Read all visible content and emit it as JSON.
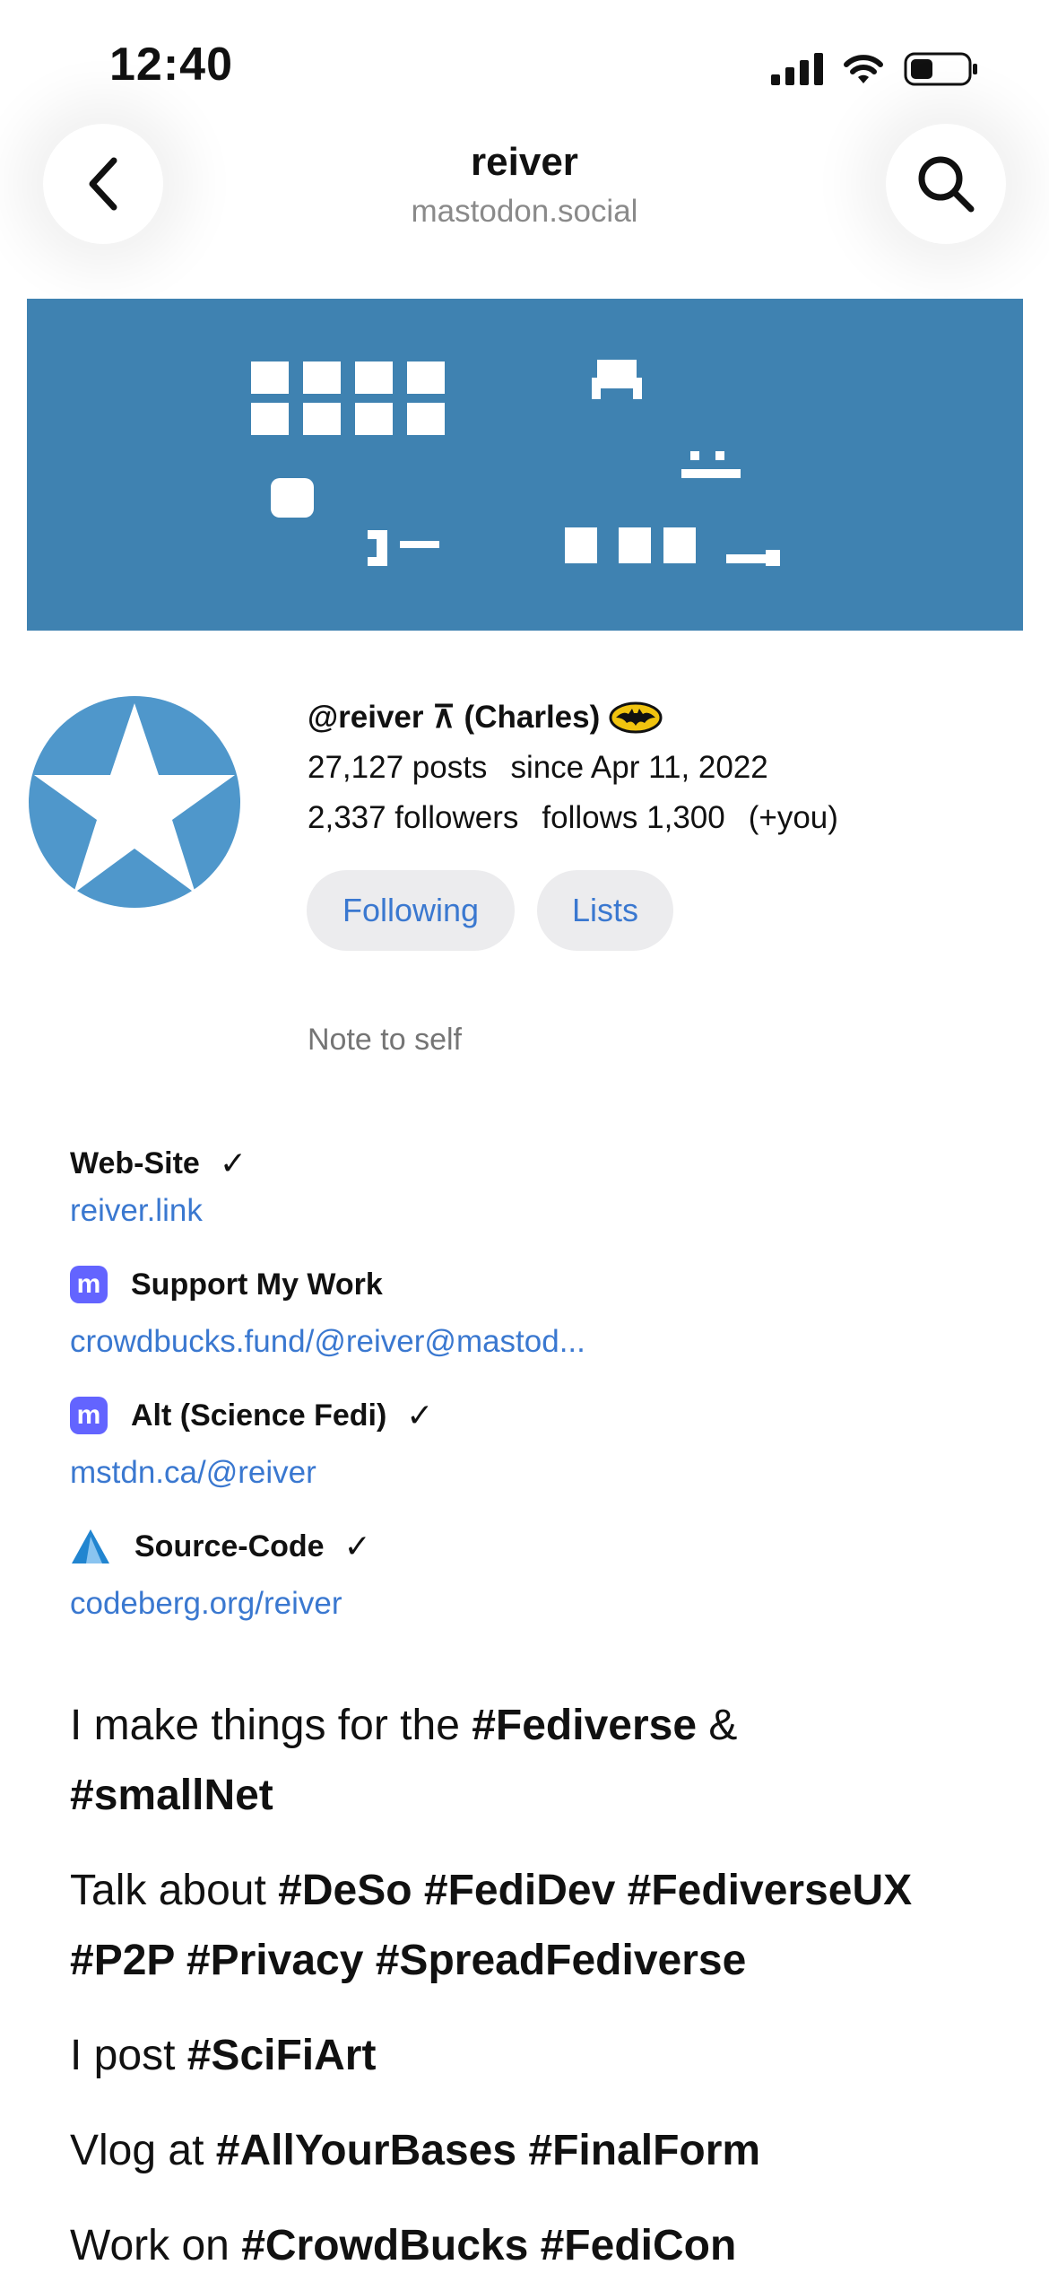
{
  "status_bar": {
    "time": "12:40"
  },
  "nav": {
    "title": "reiver",
    "subtitle": "mastodon.social"
  },
  "profile": {
    "handle": "@reiver ⊼ (Charles)",
    "posts": "27,127 posts",
    "since": "since Apr 11, 2022",
    "followers": "2,337 followers",
    "follows": "follows 1,300",
    "follows_you": "(+you)",
    "following_label": "Following",
    "lists_label": "Lists",
    "note_placeholder": "Note to self"
  },
  "fields": [
    {
      "name": "Web-Site",
      "value": "reiver.link",
      "verified": "✓"
    },
    {
      "name": "Support My Work",
      "value": "crowdbucks.fund/@reiver@mastod..."
    },
    {
      "name": "Alt (Science Fedi)",
      "value": "mstdn.ca/@reiver",
      "verified": "✓"
    },
    {
      "name": "Source-Code",
      "value": "codeberg.org/reiver",
      "verified": "✓"
    }
  ],
  "bio": {
    "line1_text": "I make things for the ",
    "line1_tag1": "#Fediverse",
    "line1_amp": " &",
    "line2_tag": "#smallNet",
    "line3_text": "Talk about ",
    "line3_tags": "#DeSo #FediDev #FediverseUX",
    "line4_tags": "#P2P #Privacy #SpreadFediverse",
    "line5_text": "I post ",
    "line5_tag": "#SciFiArt",
    "line6_text": "Vlog at ",
    "line6_tags": "#AllYourBases #FinalForm",
    "line7_text": "Work on ",
    "line7_tags": "#CrowdBucks #FediCon"
  },
  "colors": {
    "accent": "#3a78d0",
    "banner": "#3f82b1",
    "avatar": "#4f97cb",
    "pill_bg": "#ececee"
  },
  "icons": [
    "back-icon",
    "search-icon",
    "signal-icon",
    "wifi-icon",
    "battery-icon",
    "batman-emoji-icon",
    "mastodon-icon",
    "codeberg-icon",
    "star-avatar-icon"
  ]
}
